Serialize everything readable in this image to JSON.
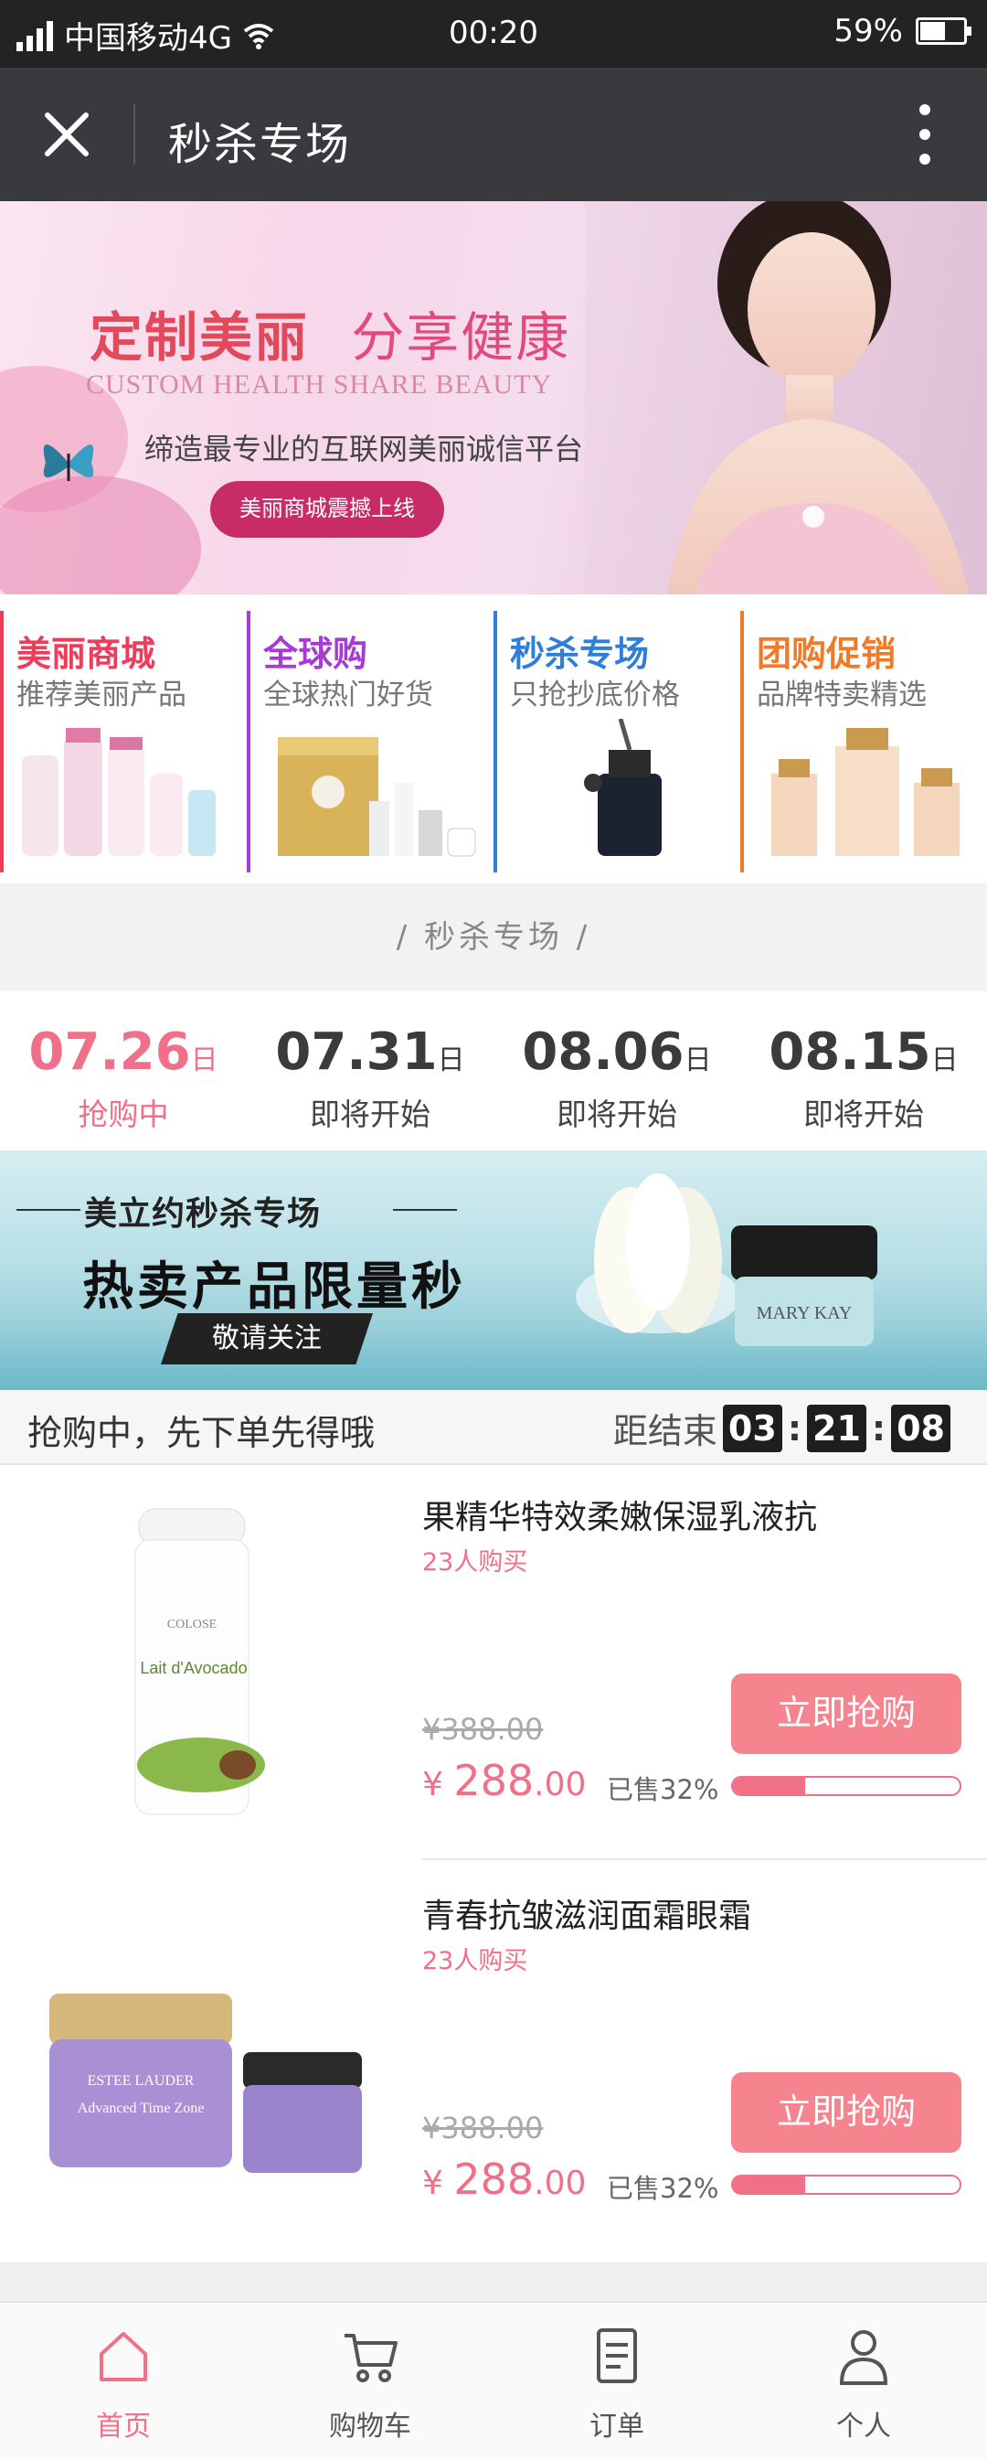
{
  "status_bar": {
    "carrier": "中国移动4G",
    "time": "00:20",
    "battery": "59%",
    "battery_level": 0.59
  },
  "navbar": {
    "title": "秒杀专场"
  },
  "hero": {
    "title_part1": "定制美丽",
    "title_part2": "分享健康",
    "english": "CUSTOM HEALTH SHARE BEAUTY",
    "subtitle": "缔造最专业的互联网美丽诚信平台",
    "button": "美丽商城震撼上线"
  },
  "categories": [
    {
      "title": "美丽商城",
      "subtitle": "推荐美丽产品",
      "color": "#ef3c5a"
    },
    {
      "title": "全球购",
      "subtitle": "全球热门好货",
      "color": "#a83bd6"
    },
    {
      "title": "秒杀专场",
      "subtitle": "只抢抄底价格",
      "color": "#2f7fd8"
    },
    {
      "title": "团购促销",
      "subtitle": "品牌特卖精选",
      "color": "#f07a28"
    }
  ],
  "section_header": "/ 秒杀专场 /",
  "dates": [
    {
      "date": "07.26",
      "day": "日",
      "status": "抢购中",
      "active": true
    },
    {
      "date": "07.31",
      "day": "日",
      "status": "即将开始",
      "active": false
    },
    {
      "date": "08.06",
      "day": "日",
      "status": "即将开始",
      "active": false
    },
    {
      "date": "08.15",
      "day": "日",
      "status": "即将开始",
      "active": false
    }
  ],
  "promo": {
    "top": "美立约秒杀专场",
    "title": "热卖产品限量秒",
    "tag": "敬请关注",
    "brand": "MARY KAY"
  },
  "countdown": {
    "text": "抢购中，先下单先得哦",
    "label": "距结束",
    "hours": "03",
    "minutes": "21",
    "seconds": "08"
  },
  "products": [
    {
      "name": "果精华特效柔嫩保湿乳液抗",
      "buyers": "23人购买",
      "old_price": "¥388.00",
      "currency": "¥",
      "price_int": "288",
      "price_dec": ".00",
      "sold": "已售32%",
      "sold_fraction": 0.32,
      "button": "立即抢购",
      "image_text": "Lait d'Avocado",
      "image_brand": "COLOSE"
    },
    {
      "name": "青春抗皱滋润面霜眼霜",
      "buyers": "23人购买",
      "old_price": "¥388.00",
      "currency": "¥",
      "price_int": "288",
      "price_dec": ".00",
      "sold": "已售32%",
      "sold_fraction": 0.32,
      "button": "立即抢购",
      "image_text": "Advanced Time Zone",
      "image_brand": "ESTEE LAUDER"
    }
  ],
  "tabbar": [
    {
      "label": "首页",
      "icon": "home-icon",
      "active": true
    },
    {
      "label": "购物车",
      "icon": "cart-icon",
      "active": false
    },
    {
      "label": "订单",
      "icon": "order-icon",
      "active": false
    },
    {
      "label": "个人",
      "icon": "person-icon",
      "active": false
    }
  ],
  "colors": {
    "accent": "#f07088",
    "navbar": "#383a3e",
    "statusbar": "#232323"
  }
}
